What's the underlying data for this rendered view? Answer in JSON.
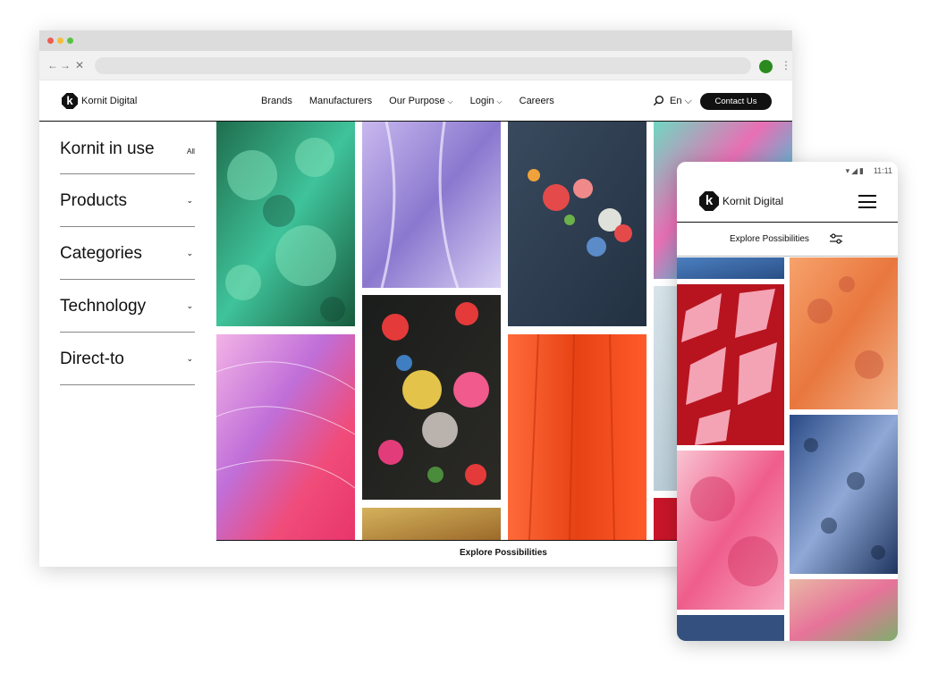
{
  "brand": {
    "name": "Kornit Digital",
    "logo_letter": "k"
  },
  "desktop": {
    "nav": {
      "items": [
        {
          "label": "Brands",
          "has_caret": false
        },
        {
          "label": "Manufacturers",
          "has_caret": false
        },
        {
          "label": "Our Purpose",
          "has_caret": true
        },
        {
          "label": "Login",
          "has_caret": true
        },
        {
          "label": "Careers",
          "has_caret": false
        }
      ],
      "caret": "⌵",
      "language": "En ⌵",
      "contact_label": "Contact Us"
    },
    "sidebar": {
      "title": "Kornit in use",
      "all_label": "All",
      "items": [
        {
          "label": "Products"
        },
        {
          "label": "Categories"
        },
        {
          "label": "Technology"
        },
        {
          "label": "Direct-to"
        }
      ],
      "chevron": "⌄"
    },
    "explore_label": "Explore Possibilities"
  },
  "mobile": {
    "status_time": "11:11",
    "status_icons": "▾◢▮",
    "explore_label": "Explore Possibilities"
  },
  "colors": {
    "accent": "#111111",
    "profile": "#2b8a1e"
  }
}
